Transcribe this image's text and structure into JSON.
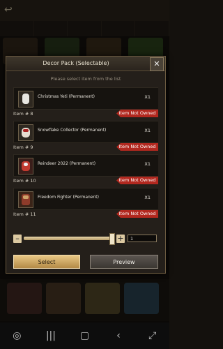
{
  "dialog": {
    "title": "Decor Pack (Selectable)",
    "subtitle": "Please select item from the list",
    "close": "✕"
  },
  "items": [
    {
      "name": "Christmas Yeti (Permanent)",
      "qty": "X1",
      "item_no": "Item # 8",
      "status": "Item Not Owned"
    },
    {
      "name": "Snowflake Collector (Permanent)",
      "qty": "X1",
      "item_no": "Item # 9",
      "status": "Item Not Owned"
    },
    {
      "name": "Reindeer 2022 (Permanent)",
      "qty": "X1",
      "item_no": "Item # 10",
      "status": "Item Not Owned"
    },
    {
      "name": "Freedom Fighter (Permanent)",
      "qty": "X1",
      "item_no": "Item # 11",
      "status": "Item Not Owned"
    }
  ],
  "quantity": {
    "minus": "–",
    "plus": "+",
    "value": "1",
    "slider_level": 1.0
  },
  "buttons": {
    "select": "Select",
    "preview": "Preview"
  },
  "colors": {
    "accent_gold": "#dcc9a1",
    "not_owned_red": "#b2281f",
    "panel": "#241f1a"
  },
  "icons": {
    "back": "back-icon",
    "close": "close-icon",
    "nav_recent": "recents-icon",
    "nav_home": "home-icon",
    "nav_back": "nav-back-icon"
  }
}
